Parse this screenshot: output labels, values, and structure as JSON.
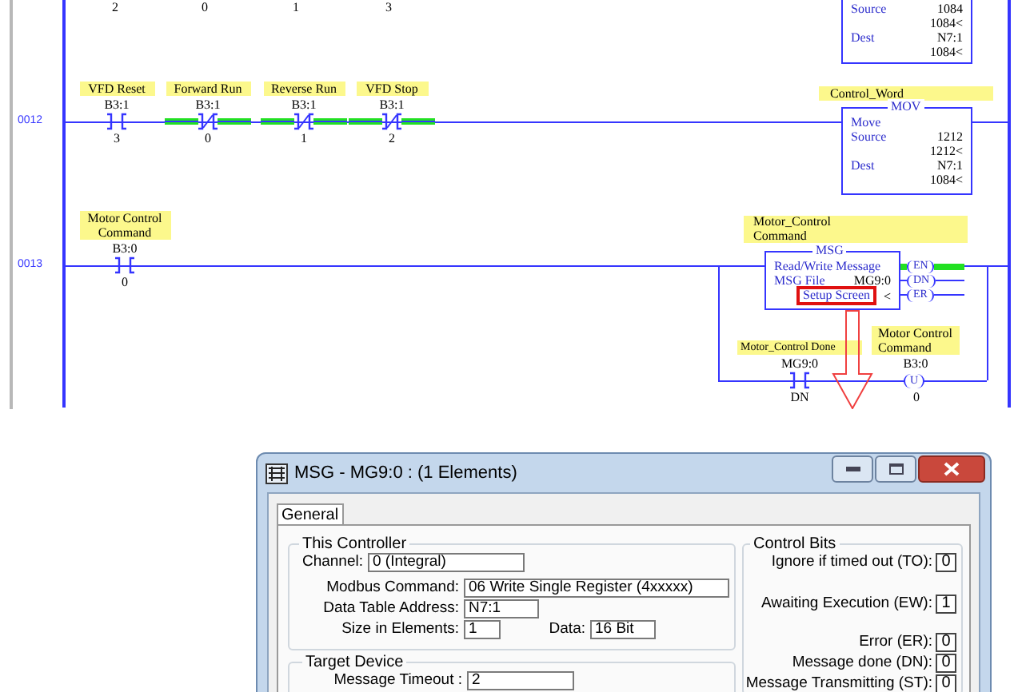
{
  "ladder": {
    "top_rung": {
      "bits": [
        "2",
        "0",
        "1",
        "3"
      ],
      "move": {
        "source_label": "Source",
        "source": "1084",
        "source_value": "1084<",
        "dest_label": "Dest",
        "dest": "N7:1",
        "dest_value": "1084<"
      }
    },
    "rungs": [
      {
        "number": "0012",
        "contacts": [
          {
            "kind": "xic",
            "label": "VFD Reset",
            "address": "B3:1",
            "bit": "3",
            "energized": false
          },
          {
            "kind": "xio",
            "label": "Forward Run",
            "address": "B3:1",
            "bit": "0",
            "energized": true
          },
          {
            "kind": "xio",
            "label": "Reverse Run",
            "address": "B3:1",
            "bit": "1",
            "energized": true
          },
          {
            "kind": "xio",
            "label": "VFD Stop",
            "address": "B3:1",
            "bit": "2",
            "energized": true
          }
        ],
        "output": {
          "kind": "mov",
          "label": "Control_Word",
          "title": "MOV",
          "name": "Move",
          "source_label": "Source",
          "source": "1212",
          "source_value": "1212<",
          "dest_label": "Dest",
          "dest": "N7:1",
          "dest_value": "1084<"
        }
      },
      {
        "number": "0013",
        "contacts": [
          {
            "kind": "xic",
            "label": "Motor Control Command",
            "address": "B3:0",
            "bit": "0",
            "energized": false
          }
        ],
        "output": {
          "kind": "msg",
          "label": "Motor_Control Command",
          "title": "MSG",
          "name": "Read/Write Message",
          "file_label": "MSG File",
          "file": "MG9:0",
          "setup": "Setup Screen",
          "setup_highlighted": true,
          "marker": "<",
          "bits": [
            {
              "name": "EN",
              "energized": true
            },
            {
              "name": "DN",
              "energized": false
            },
            {
              "name": "ER",
              "energized": false
            }
          ]
        },
        "branch": {
          "contact": {
            "kind": "xic",
            "label": "Motor_Control Done",
            "address": "MG9:0",
            "bit": "DN",
            "energized": false
          },
          "coil": {
            "kind": "unlatch",
            "label": "Motor Control Command",
            "address": "B3:0",
            "symbol": "U",
            "bit": "0"
          }
        }
      }
    ]
  },
  "dialog": {
    "title": "MSG - MG9:0 : (1 Elements)",
    "tabs": [
      {
        "label": "General",
        "selected": true
      }
    ],
    "this_controller": {
      "title": "This Controller",
      "fields": [
        {
          "label": "Channel:",
          "value": "0 (Integral)"
        },
        {
          "label": "Modbus Command:",
          "value": "06 Write Single Register (4xxxxx)"
        },
        {
          "label": "Data Table Address:",
          "value": "N7:1"
        },
        {
          "label": "Size in Elements:",
          "value": "1"
        },
        {
          "label": "Data:",
          "value": "16 Bit"
        }
      ]
    },
    "target_device": {
      "title": "Target Device",
      "fields": [
        {
          "label": "Message Timeout :",
          "value": "2"
        }
      ]
    },
    "control_bits": {
      "title": "Control Bits",
      "bits": [
        {
          "label": "Ignore if timed out (TO):",
          "value": "0"
        },
        {
          "label": "Awaiting Execution (EW):",
          "value": "1"
        },
        {
          "label": "Error (ER):",
          "value": "0"
        },
        {
          "label": "Message done (DN):",
          "value": "0"
        },
        {
          "label": "Message Transmitting (ST):",
          "value": "0"
        }
      ]
    }
  }
}
